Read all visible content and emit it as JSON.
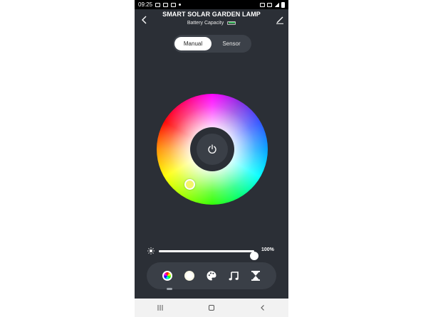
{
  "status_bar": {
    "time": "09:25"
  },
  "header": {
    "title": "SMART SOLAR GARDEN LAMP",
    "subtitle": "Battery Capacity",
    "battery_level": 1.0
  },
  "mode_tabs": [
    {
      "label": "Manual",
      "selected": true
    },
    {
      "label": "Sensor",
      "selected": false
    }
  ],
  "color_wheel": {
    "selected_color": "#f3f56a"
  },
  "brightness": {
    "value_label": "100%",
    "level": 1.0
  },
  "mode_bar": {
    "icons": [
      "color-wheel-icon",
      "white-light-icon",
      "palette-icon",
      "music-note-icon",
      "hourglass-icon"
    ]
  },
  "colors": {
    "background": "#2b2f36",
    "panel": "#3a3f47",
    "accent_white": "#ffffff",
    "battery_green": "#3fbf5f"
  }
}
